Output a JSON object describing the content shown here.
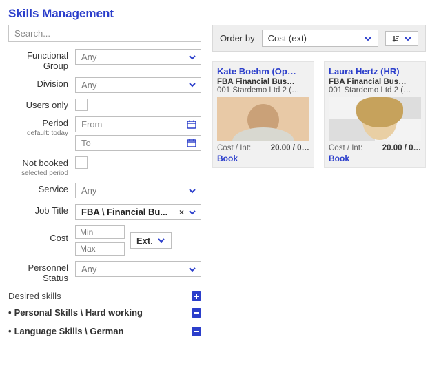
{
  "title": "Skills Management",
  "search": {
    "placeholder": "Search..."
  },
  "labels": {
    "functional_group": "Functional Group",
    "division": "Division",
    "users_only": "Users only",
    "period": "Period",
    "period_sub": "default: today",
    "not_booked": "Not booked",
    "not_booked_sub": "selected period",
    "service": "Service",
    "job_title": "Job Title",
    "cost": "Cost",
    "personnel_status": "Personnel Status",
    "desired_skills": "Desired skills",
    "order_by": "Order by"
  },
  "values": {
    "any": "Any",
    "from": "From",
    "to": "To",
    "job_title": "FBA \\ Financial Bu...",
    "min": "Min",
    "max": "Max",
    "ext": "Ext."
  },
  "skills": [
    {
      "text": "Personal Skills \\ Hard working"
    },
    {
      "text": "Language Skills \\ German"
    }
  ],
  "order": {
    "value": "Cost (ext)"
  },
  "cards": [
    {
      "name": "Kate Boehm (Op…",
      "dept": "FBA Financial Bus…",
      "company": "001 Stardemo Ltd 2 (…",
      "cost_label": "Cost / Int:",
      "cost_value": "20.00 / 0…",
      "book": "Book"
    },
    {
      "name": "Laura Hertz (HR)",
      "dept": "FBA Financial Bus…",
      "company": "001 Stardemo Ltd 2 (…",
      "cost_label": "Cost / Int:",
      "cost_value": "20.00 / 0…",
      "book": "Book"
    }
  ]
}
